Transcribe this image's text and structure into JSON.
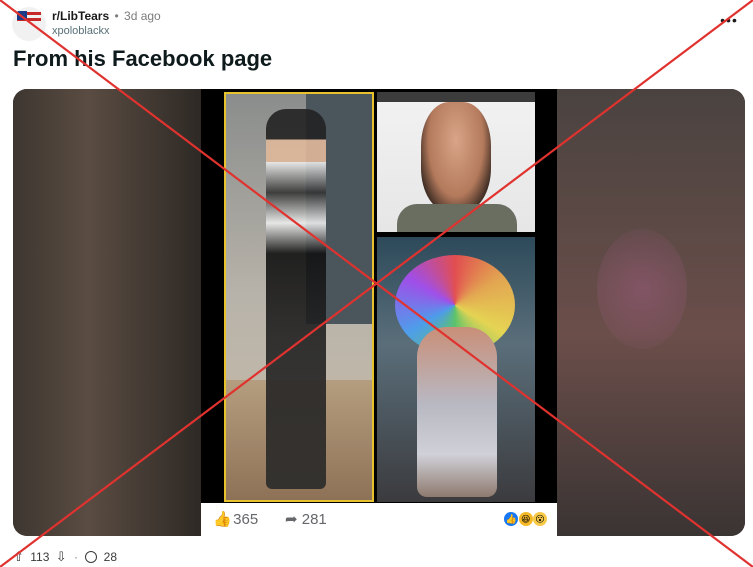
{
  "post": {
    "subreddit": "r/LibTears",
    "separator": "•",
    "time_ago": "3d ago",
    "username": "xpoloblackx",
    "more_icon": "•••",
    "title": "From his Facebook page"
  },
  "facebook_reactions": {
    "like_count": "365",
    "share_count": "281"
  },
  "actions": {
    "upvote_count": "113",
    "comment_count": "28"
  },
  "overlay": {
    "cross_color": "#e0322e"
  }
}
